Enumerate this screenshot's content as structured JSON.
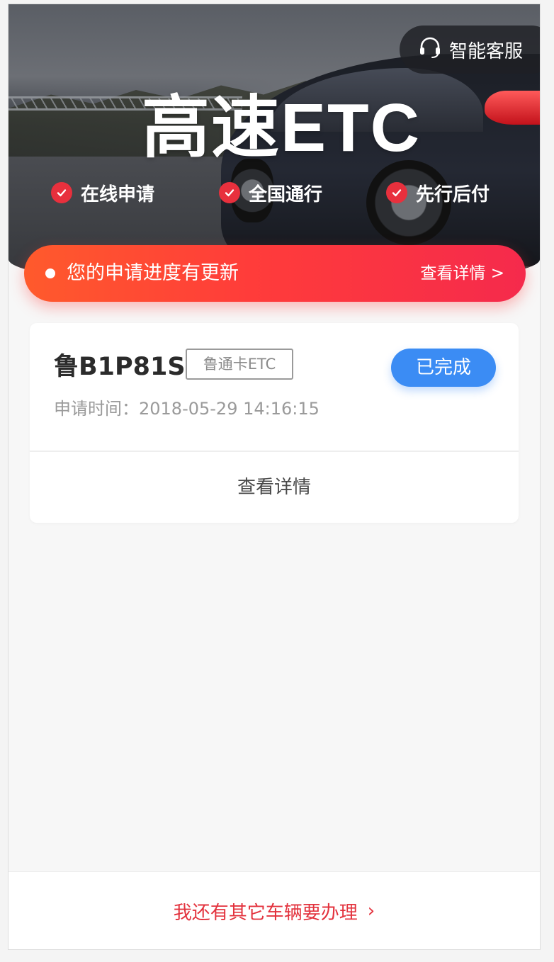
{
  "header": {
    "title": "高速ETC",
    "service_label": "智能客服",
    "features": [
      {
        "label": "在线申请",
        "icon": "check-circle-icon"
      },
      {
        "label": "全国通行",
        "icon": "check-circle-icon"
      },
      {
        "label": "先行后付",
        "icon": "check-circle-icon"
      }
    ]
  },
  "notice": {
    "message": "您的申请进度有更新",
    "action_label": "查看详情 >"
  },
  "application": {
    "plate_number": "鲁B1P81S",
    "card_type": "鲁通卡ETC",
    "status": "已完成",
    "apply_time": "申请时间：2018-05-29 14:16:15",
    "detail_label": "查看详情"
  },
  "footer": {
    "other_vehicle_label": "我还有其它车辆要办理",
    "chevron": "›"
  },
  "colors": {
    "accent_red": "#e3333e",
    "notice_gradient_start": "#ff5a2c",
    "notice_gradient_end": "#f52a4c",
    "status_blue": "#3b8cf4"
  }
}
